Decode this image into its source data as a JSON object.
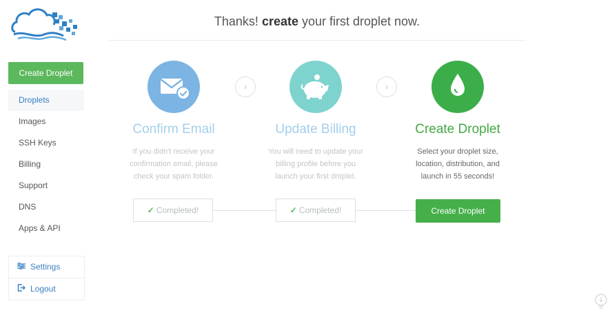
{
  "headline": {
    "prefix": "Thanks! ",
    "emphasis": "create",
    "suffix": " your first droplet now."
  },
  "sidebar": {
    "create_label": "Create Droplet",
    "items": [
      {
        "label": "Droplets",
        "active": true
      },
      {
        "label": "Images"
      },
      {
        "label": "SSH Keys"
      },
      {
        "label": "Billing"
      },
      {
        "label": "Support"
      },
      {
        "label": "DNS"
      },
      {
        "label": "Apps & API"
      }
    ],
    "bottom": [
      {
        "label": "Settings",
        "icon": "sliders-icon"
      },
      {
        "label": "Logout",
        "icon": "logout-icon"
      }
    ]
  },
  "steps": [
    {
      "title": "Confirm Email",
      "desc": "If you didn't receive your confirmation email, please check your spam folder.",
      "status": "Completed!",
      "icon": "envelope-check-icon",
      "color": "#7cb4e3"
    },
    {
      "title": "Update Billing",
      "desc": "You will need to update your billing profile before you launch your first droplet.",
      "status": "Completed!",
      "icon": "piggy-bank-icon",
      "color": "#7fd3cf"
    },
    {
      "title": "Create Droplet",
      "desc": "Select your droplet size, location, distribution, and launch in 55 seconds!",
      "action": "Create Droplet",
      "icon": "droplet-icon",
      "color": "#3bae4a"
    }
  ],
  "colors": {
    "primary_green": "#5cb85c",
    "link_blue": "#3a7fc1",
    "done_blue": "#a3cfeb"
  }
}
